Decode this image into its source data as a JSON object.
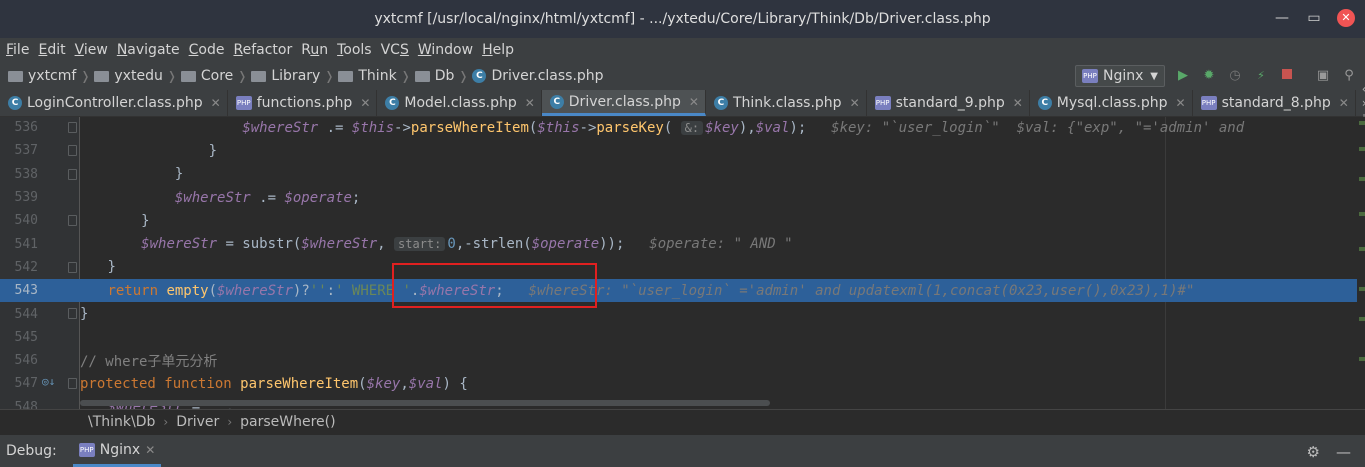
{
  "window": {
    "title": "yxtcmf [/usr/local/nginx/html/yxtcmf] - .../yxtedu/Core/Library/Think/Db/Driver.class.php"
  },
  "menu": [
    {
      "mn": "F",
      "rest": "ile"
    },
    {
      "mn": "E",
      "rest": "dit"
    },
    {
      "mn": "V",
      "rest": "iew"
    },
    {
      "mn": "N",
      "rest": "avigate"
    },
    {
      "mn": "C",
      "rest": "ode"
    },
    {
      "mn": "R",
      "rest": "efactor"
    },
    {
      "pre": "R",
      "mn": "u",
      "rest": "n"
    },
    {
      "mn": "T",
      "rest": "ools"
    },
    {
      "pre": "VC",
      "mn": "S",
      "rest": ""
    },
    {
      "mn": "W",
      "rest": "indow"
    },
    {
      "mn": "H",
      "rest": "elp"
    }
  ],
  "breadcrumb": [
    "yxtcmf",
    "yxtedu",
    "Core",
    "Library",
    "Think",
    "Db"
  ],
  "current_file": "Driver.class.php",
  "run_config": {
    "label": "Nginx",
    "badge": "PHP"
  },
  "tabs": [
    {
      "label": "LoginController.class.php",
      "icon": "C",
      "active": false
    },
    {
      "label": "functions.php",
      "icon": "PHP",
      "active": false
    },
    {
      "label": "Model.class.php",
      "icon": "C",
      "active": false
    },
    {
      "label": "Driver.class.php",
      "icon": "C",
      "active": true
    },
    {
      "label": "Think.class.php",
      "icon": "C",
      "active": false
    },
    {
      "label": "standard_9.php",
      "icon": "PHP",
      "active": false
    },
    {
      "label": "Mysql.class.php",
      "icon": "C",
      "active": false
    },
    {
      "label": "standard_8.php",
      "icon": "PHP",
      "active": false
    }
  ],
  "code": {
    "highlight_line": "543",
    "lines": [
      {
        "n": "536",
        "indent": 24,
        "tokens": [
          [
            "var",
            "$whereStr"
          ],
          [
            "code",
            " .= "
          ],
          [
            "var",
            "$this"
          ],
          [
            "code",
            "->"
          ],
          [
            "fn",
            "parseWhereItem"
          ],
          [
            "code",
            "("
          ],
          [
            "var",
            "$this"
          ],
          [
            "code",
            "->"
          ],
          [
            "fn",
            "parseKey"
          ],
          [
            "code",
            "( "
          ],
          [
            "param",
            "&:"
          ],
          [
            "var",
            "$key"
          ],
          [
            "code",
            "),"
          ],
          [
            "var",
            "$val"
          ],
          [
            "code",
            ");  "
          ],
          [
            "hint",
            "$key: \"`user_login`\"  $val: {\"exp\", \"='admin' and"
          ]
        ]
      },
      {
        "n": "537",
        "indent": 20,
        "tokens": [
          [
            "code",
            "}"
          ]
        ]
      },
      {
        "n": "538",
        "indent": 16,
        "tokens": [
          [
            "code",
            "}"
          ]
        ]
      },
      {
        "n": "539",
        "indent": 16,
        "tokens": [
          [
            "var",
            "$whereStr"
          ],
          [
            "code",
            " .= "
          ],
          [
            "var",
            "$operate"
          ],
          [
            "code",
            ";"
          ]
        ]
      },
      {
        "n": "540",
        "indent": 12,
        "tokens": [
          [
            "code",
            "}"
          ]
        ]
      },
      {
        "n": "541",
        "indent": 12,
        "tokens": [
          [
            "var",
            "$whereStr"
          ],
          [
            "code",
            " = substr("
          ],
          [
            "var",
            "$whereStr"
          ],
          [
            "code",
            ", "
          ],
          [
            "param",
            "start:"
          ],
          [
            "num",
            "0"
          ],
          [
            "code",
            ",-strlen("
          ],
          [
            "var",
            "$operate"
          ],
          [
            "code",
            "));  "
          ],
          [
            "hint",
            "$operate: \" AND \""
          ]
        ]
      },
      {
        "n": "542",
        "indent": 8,
        "tokens": [
          [
            "code",
            "}"
          ]
        ]
      },
      {
        "n": "543",
        "indent": 8,
        "tokens": [
          [
            "kw",
            "return "
          ],
          [
            "fn",
            "empty"
          ],
          [
            "code",
            "("
          ],
          [
            "var",
            "$whereStr"
          ],
          [
            "code",
            ")?"
          ],
          [
            "str",
            "''"
          ],
          [
            "code",
            ":"
          ],
          [
            "str",
            "' WHERE '"
          ],
          [
            "code",
            "."
          ],
          [
            "var",
            "$whereStr"
          ],
          [
            "code",
            ";  "
          ],
          [
            "hint",
            "$whereStr: \"`user_login` ='admin' and updatexml(1,concat(0x23,user(),0x23),1)#\""
          ]
        ]
      },
      {
        "n": "544",
        "indent": 4,
        "tokens": [
          [
            "code",
            "}"
          ]
        ]
      },
      {
        "n": "545",
        "indent": 0,
        "tokens": []
      },
      {
        "n": "546",
        "indent": 4,
        "tokens": [
          [
            "cmt",
            "// where子单元分析"
          ]
        ]
      },
      {
        "n": "547",
        "indent": 4,
        "tokens": [
          [
            "kw",
            "protected function "
          ],
          [
            "fn",
            "parseWhereItem"
          ],
          [
            "code",
            "("
          ],
          [
            "var",
            "$key"
          ],
          [
            "code",
            ","
          ],
          [
            "var",
            "$val"
          ],
          [
            "code",
            ") {"
          ]
        ]
      },
      {
        "n": "548",
        "indent": 8,
        "tokens": [
          [
            "var",
            "$whereStr"
          ],
          [
            "code",
            " = "
          ],
          [
            "str",
            "''"
          ],
          [
            "code",
            ";"
          ]
        ]
      }
    ]
  },
  "struct_breadcrumb": [
    "\\Think\\Db",
    "Driver",
    "parseWhere()"
  ],
  "debug": {
    "label": "Debug:",
    "tab": "Nginx"
  }
}
